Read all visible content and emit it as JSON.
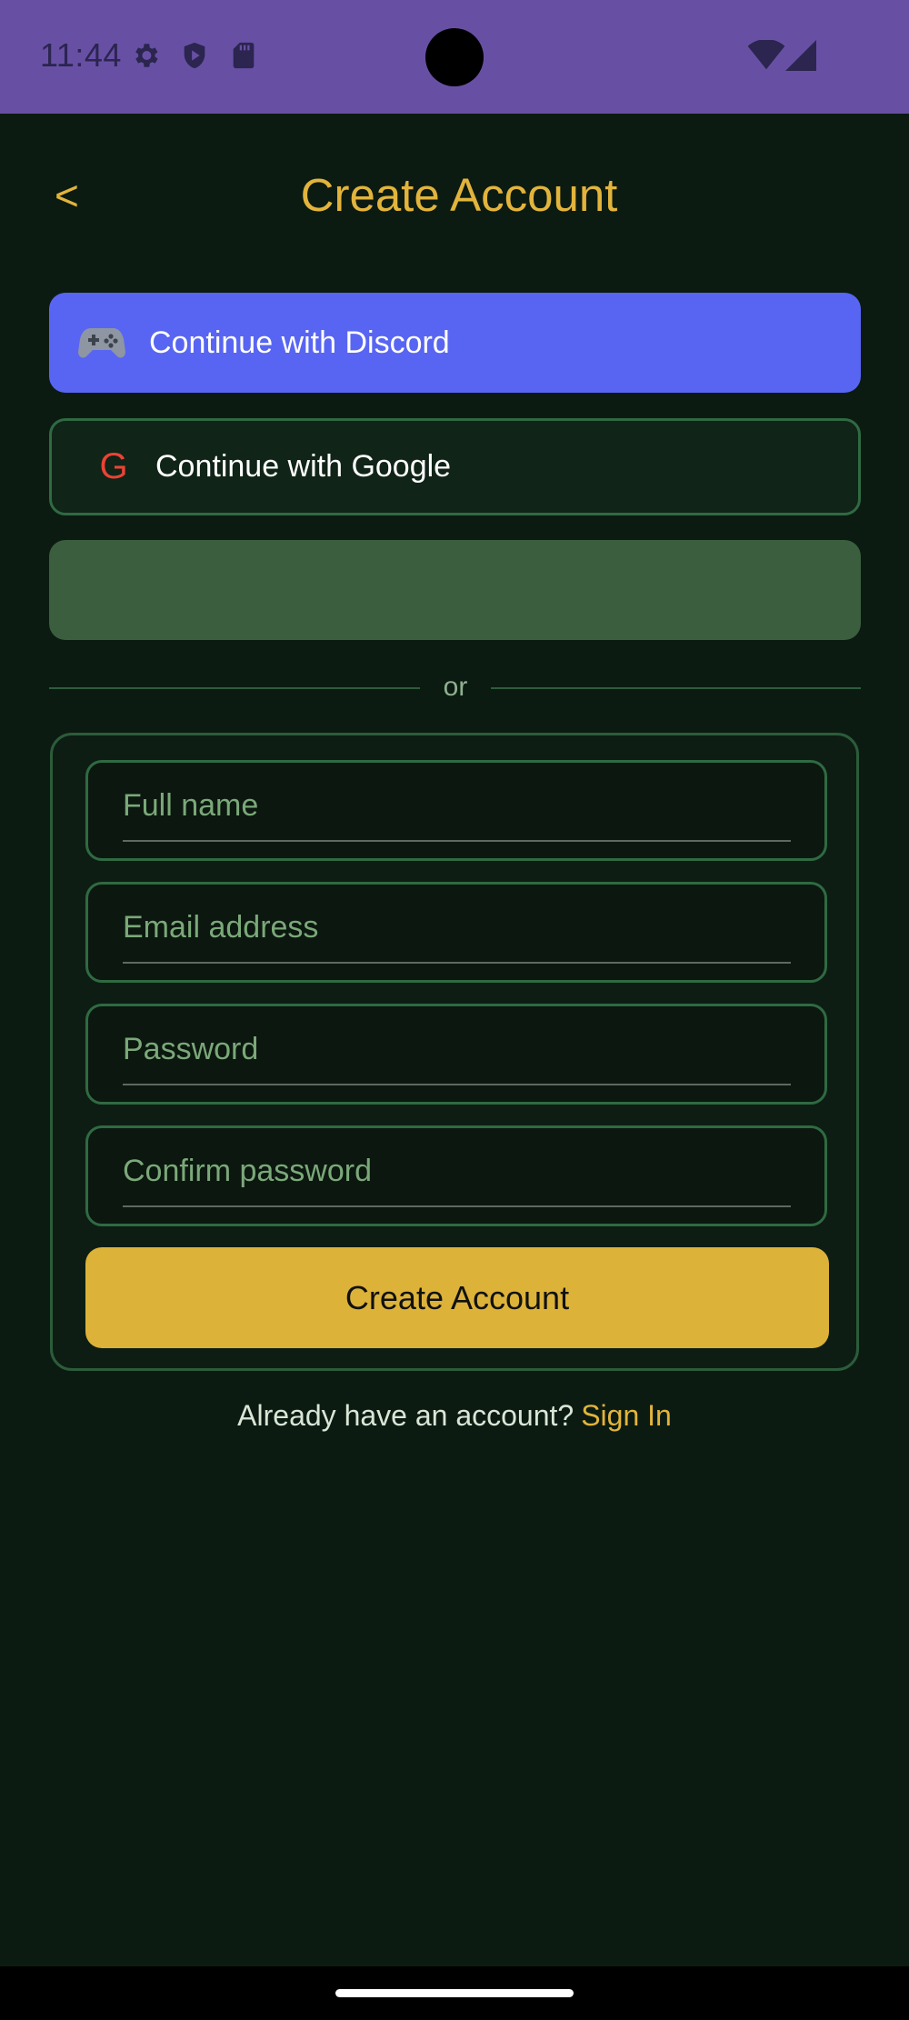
{
  "status_bar": {
    "time": "11:44",
    "color": "#6750a4",
    "icons": [
      "gear-icon",
      "shield-icon",
      "sd-card-icon",
      "wifi-icon",
      "cellular-icon"
    ]
  },
  "header": {
    "back_label": "<",
    "title": "Create Account"
  },
  "social": {
    "discord_label": "Continue with Discord",
    "discord_color": "#5865f2",
    "google_icon_letter": "G",
    "google_label": "Continue with Google",
    "third_label": ""
  },
  "divider": {
    "text": "or"
  },
  "form": {
    "full_name": {
      "placeholder": "Full name",
      "value": ""
    },
    "email": {
      "placeholder": "Email address",
      "value": ""
    },
    "password": {
      "placeholder": "Password",
      "value": ""
    },
    "confirm_password": {
      "placeholder": "Confirm password",
      "value": ""
    },
    "submit_label": "Create Account",
    "accent_color": "#dcb239"
  },
  "footer": {
    "prompt": "Already have an account?",
    "link": "Sign In"
  }
}
